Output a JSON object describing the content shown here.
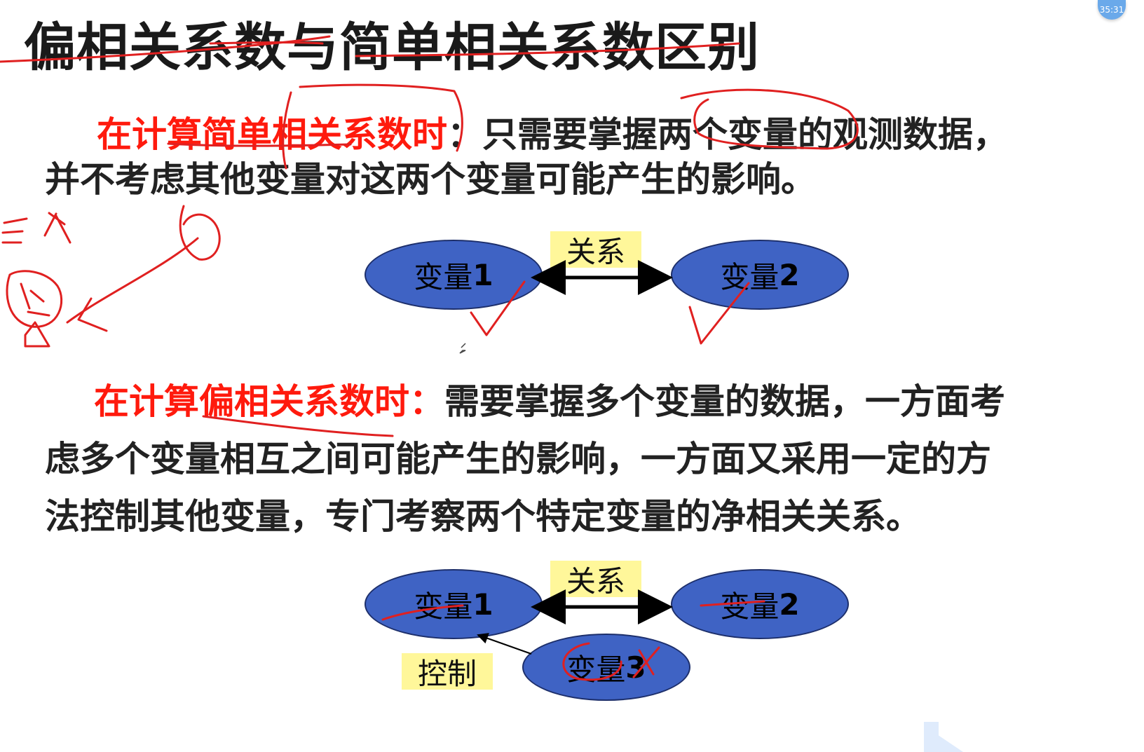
{
  "title": "偏相关系数与简单相关系数区别",
  "timer": "35:31",
  "section1": {
    "lead": "在计算简单相关系数时",
    "line1_rest": "：只需要掌握两个变量的观测数据，",
    "line2": "并不考虑其他变量对这两个变量可能产生的影响。"
  },
  "diagram1": {
    "var1": "变量",
    "var1_num": "1",
    "var2": "变量",
    "var2_num": "2",
    "relation": "关系"
  },
  "section2": {
    "lead": "在计算偏相关系数时：",
    "line1_rest": "需要掌握多个变量的数据，一方面考",
    "line2": "虑多个变量相互之间可能产生的影响，一方面又采用一定的方",
    "line3": "法控制其他变量，专门考察两个特定变量的净相关关系。"
  },
  "diagram2": {
    "var1": "变量",
    "var1_num": "1",
    "var2": "变量",
    "var2_num": "2",
    "var3": "变量",
    "var3_num": "3",
    "relation": "关系",
    "control": "控制"
  },
  "colors": {
    "red_text": "#ff1a0d",
    "oval_fill": "#3f63c4",
    "label_fill": "#fff79a",
    "ink": "#e02020"
  }
}
